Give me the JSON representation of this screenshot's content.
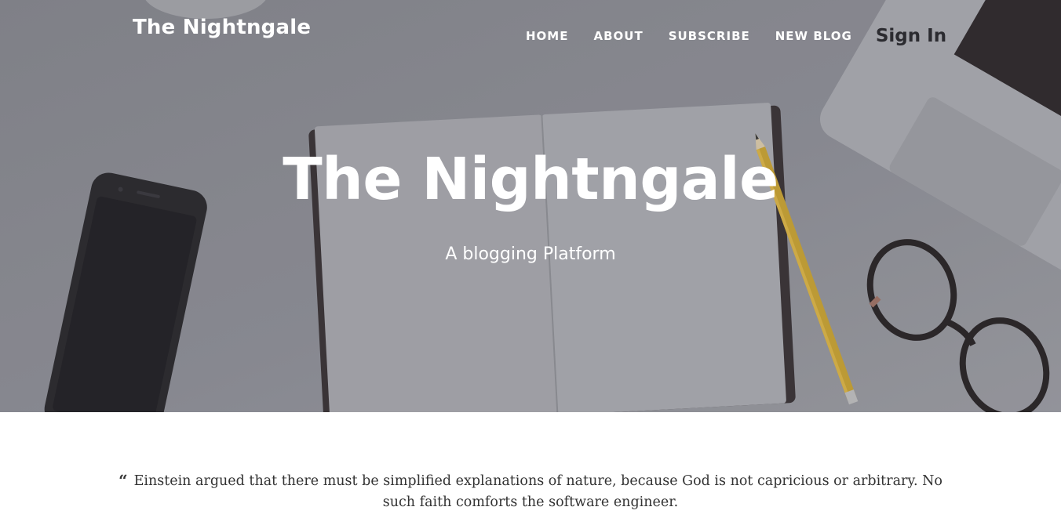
{
  "navbar": {
    "brand": "The Nightngale",
    "links": [
      {
        "label": "HOME"
      },
      {
        "label": "ABOUT"
      },
      {
        "label": "SUBSCRIBE"
      },
      {
        "label": "NEW BLOG"
      }
    ],
    "signin_label": "Sign In"
  },
  "hero": {
    "title": "The Nightngale",
    "subtitle": "A blogging Platform"
  },
  "quote": {
    "icon": "quote-left-icon",
    "text": "Einstein argued that there must be simplified explanations of nature, because God is not capricious or arbitrary. No such faith comforts the software engineer."
  },
  "colors": {
    "hero_bg": "#8b8c93",
    "nav_text": "#ffffff",
    "signin_text": "#2b2b30",
    "quote_text": "#333333"
  }
}
